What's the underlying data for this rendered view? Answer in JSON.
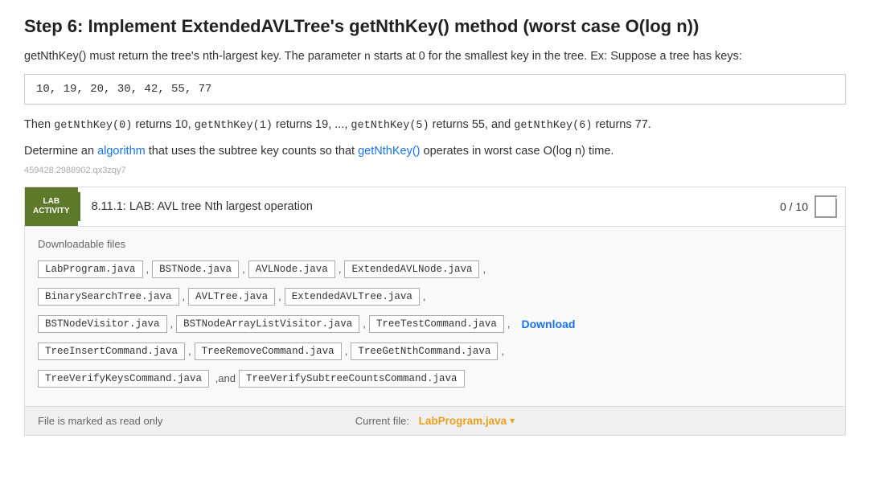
{
  "page": {
    "title": "Step 6: Implement ExtendedAVLTree's getNthKey() method (worst case O(log n))",
    "intro": {
      "text1": "getNthKey() must return the tree's nth-largest key. The parameter ",
      "n_param": "n",
      "text2": " starts at 0 for the smallest key in the tree. Ex: Suppose a tree has keys:"
    },
    "code_example": "10, 19, 20, 30, 42, 55, 77",
    "then_line": {
      "prefix": "Then ",
      "items": [
        {
          "code": "getNthKey(0)",
          "text": " returns 10, "
        },
        {
          "code": "getNthKey(1)",
          "text": " returns 19, ..., "
        },
        {
          "code": "getNthKey(5)",
          "text": " returns 55, and "
        },
        {
          "code": "getNthKey(6)",
          "text": " returns 77."
        }
      ]
    },
    "determine_line": "Determine an algorithm that uses the subtree key counts so that getNthKey() operates in worst case O(log n) time.",
    "id_line": "459428.2988902.qx3zqy7",
    "lab_activity": {
      "badge_line1": "LAB",
      "badge_line2": "ACTIVITY",
      "title": "8.11.1: LAB: AVL tree Nth largest operation",
      "score": "0 / 10"
    },
    "downloadable": {
      "label": "Downloadable files",
      "rows": [
        {
          "files": [
            "LabProgram.java",
            "BSTNode.java",
            "AVLNode.java",
            "ExtendedAVLNode.java"
          ],
          "seps": [
            ",",
            ",",
            ",",
            ","
          ]
        },
        {
          "files": [
            "BinarySearchTree.java",
            "AVLTree.java",
            "ExtendedAVLTree.java"
          ],
          "seps": [
            ",",
            ",",
            ","
          ]
        },
        {
          "files": [
            "BSTNodeVisitor.java",
            "BSTNodeArrayListVisitor.java",
            "TreeTestCommand.java"
          ],
          "seps": [
            ",",
            ",",
            ","
          ],
          "has_download": true,
          "download_label": "Download"
        },
        {
          "files": [
            "TreeInsertCommand.java",
            "TreeRemoveCommand.java",
            "TreeGetNthCommand.java"
          ],
          "seps": [
            ",",
            ",",
            ","
          ]
        },
        {
          "files_special": [
            {
              "name": "TreeVerifyKeysCommand.java",
              "sep": ",and"
            },
            {
              "name": "TreeVerifySubtreeCountsCommand.java",
              "sep": ""
            }
          ]
        }
      ]
    },
    "bottom_bar": {
      "read_only_label": "File is marked as read only",
      "current_file_label": "Current file:",
      "current_file_name": "LabProgram.java",
      "dropdown_symbol": "▾"
    }
  }
}
